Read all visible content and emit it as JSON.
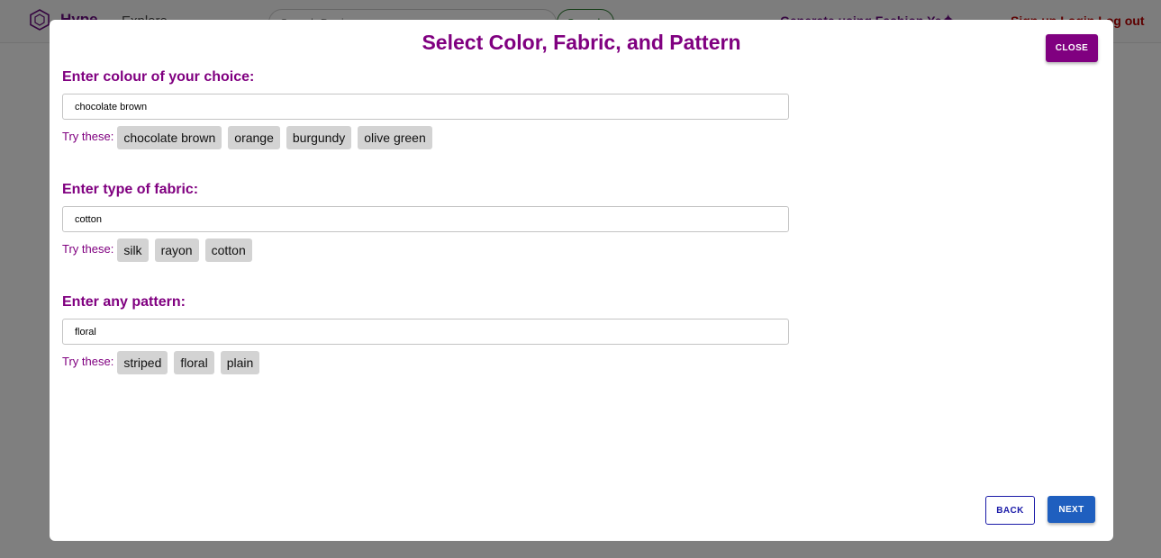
{
  "header": {
    "brand": "Hype",
    "explore": "Explore",
    "search_placeholder": "Search Designs",
    "search_button": "Search",
    "links": "Generate using Fashion Ye",
    "right_links": "Sign up    Login   Log out"
  },
  "modal": {
    "title": "Select Color, Fabric, and Pattern",
    "close_label": "CLOSE",
    "back_label": "BACK",
    "next_label": "NEXT",
    "try_label": "Try these:",
    "sections": [
      {
        "label": "Enter colour of your choice:",
        "value": "chocolate brown",
        "suggestions": [
          "chocolate brown",
          "orange",
          "burgundy",
          "olive green"
        ]
      },
      {
        "label": "Enter type of fabric:",
        "value": "cotton",
        "suggestions": [
          "silk",
          "rayon",
          "cotton"
        ]
      },
      {
        "label": "Enter any pattern:",
        "value": "floral",
        "suggestions": [
          "striped",
          "floral",
          "plain"
        ]
      }
    ]
  },
  "colors": {
    "accent": "#800080",
    "primary_button": "#1f5fbf",
    "chip": "#d3d3d3"
  }
}
